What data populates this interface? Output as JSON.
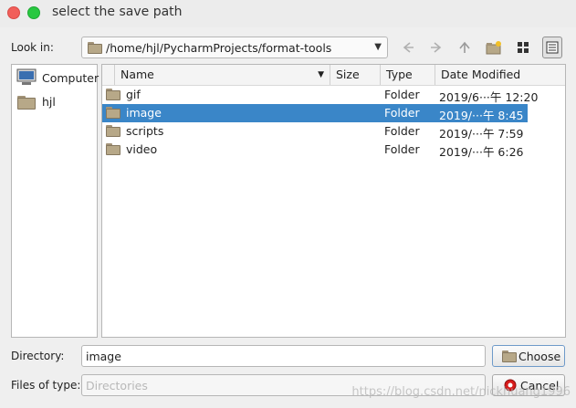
{
  "window": {
    "title": "select the save path"
  },
  "lookin": {
    "label": "Look in:",
    "path": "/home/hjl/PycharmProjects/format-tools",
    "toolbar": [
      "back-arrow-icon",
      "forward-arrow-icon",
      "up-arrow-icon",
      "new-folder-icon",
      "icon-view-icon",
      "detail-view-icon"
    ]
  },
  "sidebar": {
    "items": [
      {
        "label": "Computer",
        "icon": "computer-icon"
      },
      {
        "label": "hjl",
        "icon": "folder-icon"
      }
    ]
  },
  "table": {
    "headers": [
      "Name",
      "Size",
      "Type",
      "Date Modified"
    ],
    "rows": [
      {
        "name": "gif",
        "size": "",
        "type": "Folder",
        "date": "2019/6···午 12:20"
      },
      {
        "name": "image",
        "size": "",
        "type": "Folder",
        "date": "2019/···午 8:45"
      },
      {
        "name": "scripts",
        "size": "",
        "type": "Folder",
        "date": "2019/···午 7:59"
      },
      {
        "name": "video",
        "size": "",
        "type": "Folder",
        "date": "2019/···午 6:26"
      }
    ],
    "selected_index": 1
  },
  "directory": {
    "label": "Directory:",
    "value": "image",
    "button": "Choose"
  },
  "filetype": {
    "label": "Files of type:",
    "value": "Directories",
    "button": "Cancel"
  },
  "watermark": "https://blog.csdn.net/nickhuang1996",
  "colors": {
    "selection": "#3a86c8",
    "close": "#f15f5a",
    "maximize": "#28c840"
  }
}
